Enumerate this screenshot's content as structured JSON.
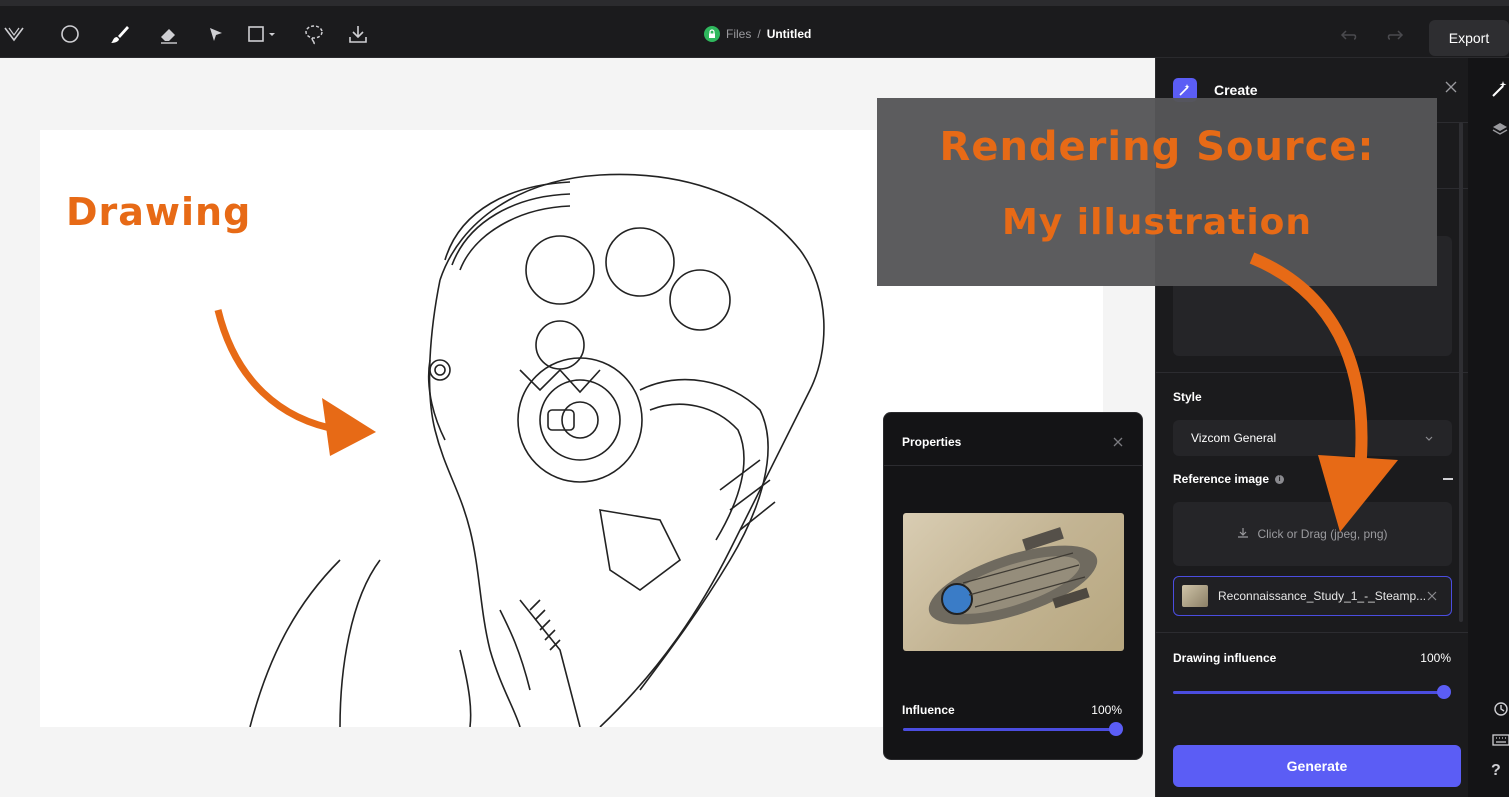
{
  "toolbar": {
    "tools": [
      "logo-icon",
      "color-circle-icon",
      "brush-icon",
      "eraser-icon",
      "select-arrow-icon",
      "shape-rect-icon",
      "lasso-icon",
      "download-icon"
    ],
    "breadcrumb_root": "Files",
    "breadcrumb_sep": "/",
    "breadcrumb_current": "Untitled",
    "export_label": "Export"
  },
  "canvas": {
    "annotation_drawing": "Drawing"
  },
  "properties": {
    "title": "Properties",
    "influence_label": "Influence",
    "influence_value": "100%",
    "influence_fraction": 1.0
  },
  "panel": {
    "title": "Create",
    "style_label": "Style",
    "style_value": "Vizcom General",
    "reference_label": "Reference image",
    "dropzone_text": "Click or Drag (jpeg, png)",
    "reference_file": "Reconnaissance_Study_1_-_Steamp...",
    "drawing_influence_label": "Drawing influence",
    "drawing_influence_value": "100%",
    "drawing_influence_fraction": 1.0,
    "generate_label": "Generate"
  },
  "overlay": {
    "line1": "Rendering Source:",
    "line2": "My illustration"
  },
  "colors": {
    "accent": "#5b5df5",
    "annotation": "#e76a16"
  }
}
